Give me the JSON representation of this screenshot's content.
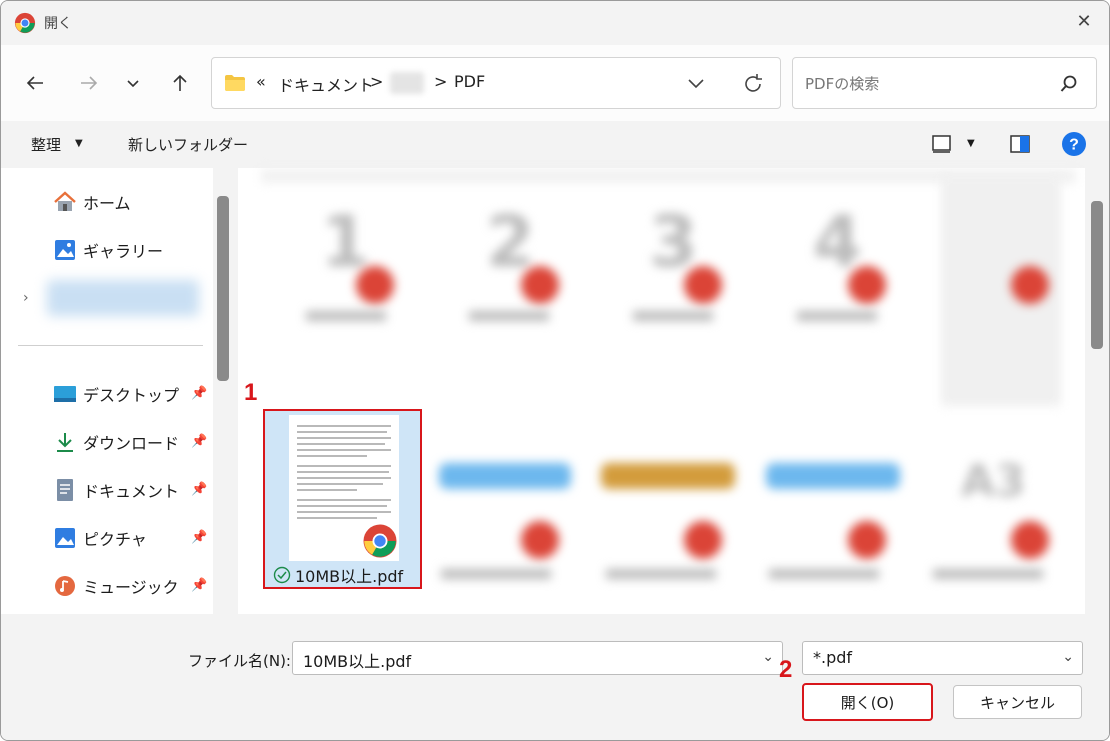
{
  "window": {
    "title": "開く"
  },
  "nav": {
    "breadcrumb": [
      "«",
      "ドキュメント",
      ">",
      "",
      ">",
      "PDF"
    ],
    "search_placeholder": "PDFの検索"
  },
  "toolbar": {
    "organize": "整理",
    "new_folder": "新しいフォルダー"
  },
  "sidebar": {
    "items": [
      {
        "label": "ホーム",
        "icon": "home-icon"
      },
      {
        "label": "ギャラリー",
        "icon": "gallery-icon"
      },
      {
        "label": "デスクトップ",
        "icon": "desktop-icon",
        "pinned": true
      },
      {
        "label": "ダウンロード",
        "icon": "download-icon",
        "pinned": true
      },
      {
        "label": "ドキュメント",
        "icon": "documents-icon",
        "pinned": true
      },
      {
        "label": "ピクチャ",
        "icon": "pictures-icon",
        "pinned": true
      },
      {
        "label": "ミュージック",
        "icon": "music-icon",
        "pinned": true
      }
    ]
  },
  "content": {
    "selected_file": "10MB以上.pdf",
    "blurred_labels": [
      "1",
      "2",
      "3",
      "4",
      "A3"
    ]
  },
  "annotations": {
    "step1": "1",
    "step2": "2"
  },
  "bottom": {
    "filename_label": "ファイル名(N):",
    "filename_value": "10MB以上.pdf",
    "filter_value": "*.pdf",
    "open_button": "開く(O)",
    "cancel_button": "キャンセル"
  },
  "colors": {
    "highlight": "#d8161b",
    "selection": "#cfe5f7",
    "help": "#1a73e8"
  }
}
